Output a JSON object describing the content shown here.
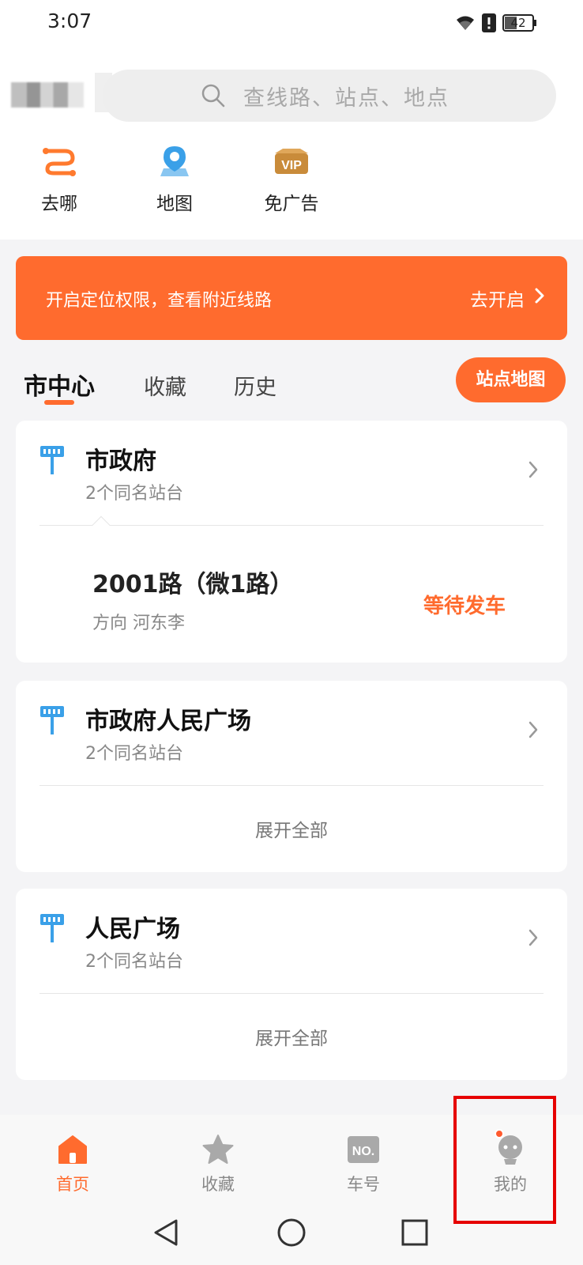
{
  "status_bar": {
    "time": "3:07",
    "battery": "42"
  },
  "search": {
    "placeholder": "查线路、站点、地点"
  },
  "quick_actions": [
    {
      "label": "去哪",
      "icon": "route-icon"
    },
    {
      "label": "地图",
      "icon": "map-pin-icon"
    },
    {
      "label": "免广告",
      "icon": "vip-icon"
    }
  ],
  "banner": {
    "text": "开启定位权限，查看附近线路",
    "action": "去开启"
  },
  "tabs": [
    "市中心",
    "收藏",
    "历史"
  ],
  "station_map_button": "站点地图",
  "stops": [
    {
      "name": "市政府",
      "sub": "2个同名站台",
      "route": {
        "name": "2001路（微1路）",
        "direction": "方向 河东李",
        "status": "等待发车"
      }
    },
    {
      "name": "市政府人民广场",
      "sub": "2个同名站台",
      "expand": "展开全部"
    },
    {
      "name": "人民广场",
      "sub": "2个同名站台",
      "expand": "展开全部"
    }
  ],
  "bottom_nav": [
    {
      "label": "首页",
      "icon": "home-icon",
      "active": true
    },
    {
      "label": "收藏",
      "icon": "star-icon",
      "active": false
    },
    {
      "label": "车号",
      "icon": "bus-number-icon",
      "active": false
    },
    {
      "label": "我的",
      "icon": "profile-icon",
      "active": false
    }
  ],
  "colors": {
    "accent": "#ff6b2e",
    "stop_icon": "#3aa0e8",
    "highlight": "#e60000"
  }
}
